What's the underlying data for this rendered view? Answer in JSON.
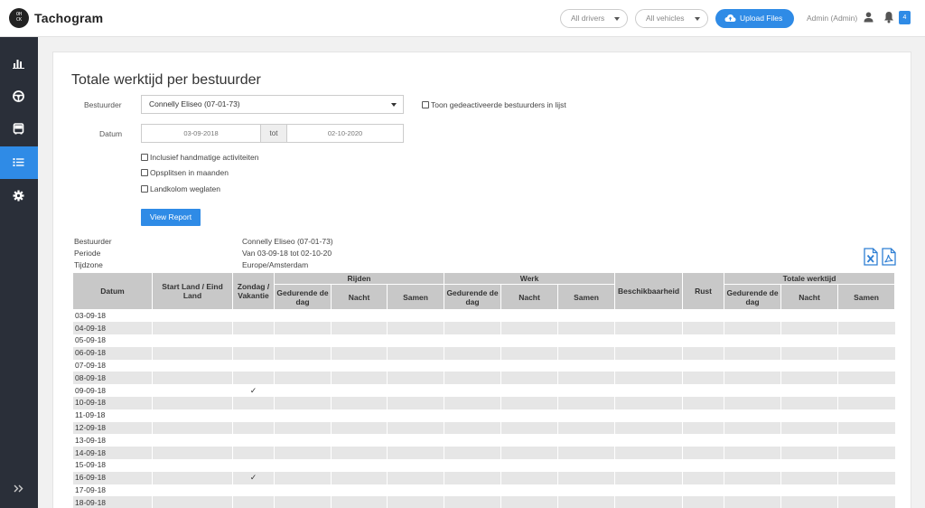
{
  "app": {
    "logo_text": "OH\nCK",
    "brand": "Tachogram"
  },
  "topbar": {
    "drivers_filter": "All drivers",
    "vehicles_filter": "All vehicles",
    "upload_label": "Upload Files",
    "user_label": "Admin (Admin)",
    "notification_count": "4",
    "accent_color": "#2f8be6"
  },
  "sidebar": {
    "items": [
      {
        "icon": "bar-chart-icon",
        "active": false
      },
      {
        "icon": "steering-wheel-icon",
        "active": false
      },
      {
        "icon": "bus-icon",
        "active": false
      },
      {
        "icon": "list-icon",
        "active": true
      },
      {
        "icon": "gear-icon",
        "active": false
      }
    ],
    "collapse_icon": "double-chevron-right-icon"
  },
  "form": {
    "title": "Totale werktijd per bestuurder",
    "driver_label": "Bestuurder",
    "driver_value": "Connelly Eliseo (07-01-73)",
    "show_deactivated_label": "Toon gedeactiveerde bestuurders in lijst",
    "date_label": "Datum",
    "date_from": "03-09-2018",
    "date_sep": "tot",
    "date_to": "02-10-2020",
    "option_manual": "Inclusief handmatige activiteiten",
    "option_split": "Opsplitsen in maanden",
    "option_country": "Landkolom weglaten",
    "view_button": "View Report"
  },
  "report_info": {
    "driver_label": "Bestuurder",
    "driver_value": "Connelly Eliseo (07-01-73)",
    "period_label": "Periode",
    "period_value": "Van 03-09-18 tot 02-10-20",
    "timezone_label": "Tijdzone",
    "timezone_value": "Europe/Amsterdam"
  },
  "table": {
    "group_headers": {
      "rijden": "Rijden",
      "werk": "Werk",
      "totale": "Totale werktijd"
    },
    "headers": {
      "datum": "Datum",
      "start_land": "Start Land / Eind Land",
      "zondag": "Zondag / Vakantie",
      "gedurende": "Gedurende de dag",
      "nacht": "Nacht",
      "samen": "Samen",
      "beschikbaarheid": "Beschikbaarheid",
      "rust": "Rust"
    },
    "rows": [
      {
        "date": "03-09-18",
        "check": ""
      },
      {
        "date": "04-09-18",
        "check": ""
      },
      {
        "date": "05-09-18",
        "check": ""
      },
      {
        "date": "06-09-18",
        "check": ""
      },
      {
        "date": "07-09-18",
        "check": ""
      },
      {
        "date": "08-09-18",
        "check": ""
      },
      {
        "date": "09-09-18",
        "check": "✓"
      },
      {
        "date": "10-09-18",
        "check": ""
      },
      {
        "date": "11-09-18",
        "check": ""
      },
      {
        "date": "12-09-18",
        "check": ""
      },
      {
        "date": "13-09-18",
        "check": ""
      },
      {
        "date": "14-09-18",
        "check": ""
      },
      {
        "date": "15-09-18",
        "check": ""
      },
      {
        "date": "16-09-18",
        "check": "✓"
      },
      {
        "date": "17-09-18",
        "check": ""
      },
      {
        "date": "18-09-18",
        "check": ""
      }
    ]
  }
}
